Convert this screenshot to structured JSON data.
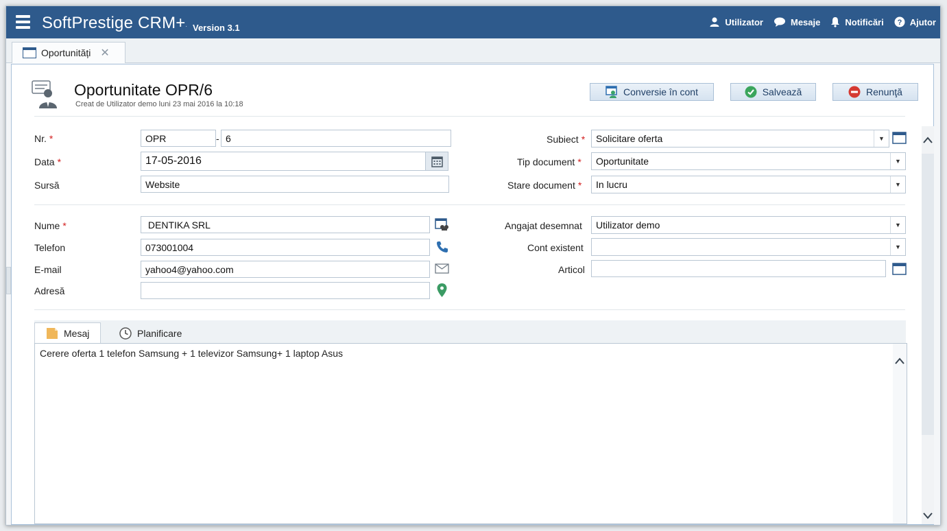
{
  "app": {
    "title": "SoftPrestige CRM+",
    "separator": "·",
    "version": "Version 3.1",
    "brand_color": "#2e5a8c"
  },
  "topnav": {
    "user": "Utilizator",
    "messages": "Mesaje",
    "notifications": "Notificări",
    "help": "Ajutor"
  },
  "tabs": [
    {
      "label": "Oportunități",
      "close": "✕"
    }
  ],
  "header": {
    "title": "Oportunitate OPR/6",
    "created": "Creat de Utilizator demo luni 23 mai 2016 la 10:18"
  },
  "actions": {
    "convert": "Conversie în cont",
    "save": "Salvează",
    "cancel": "Renunţă"
  },
  "form": {
    "nr_label": "Nr.",
    "nr_prefix": "OPR",
    "nr_dash": "-",
    "nr_value": "6",
    "date_label": "Data",
    "date_value": "17-05-2016",
    "source_label": "Sursă",
    "source_value": "Website",
    "name_label": "Nume",
    "name_value": " DENTIKA SRL",
    "phone_label": "Telefon",
    "phone_value": "073001004",
    "email_label": "E-mail",
    "email_value": "yahoo4@yahoo.com",
    "address_label": "Adresă",
    "address_value": "",
    "subject_label": "Subiect",
    "subject_value": "Solicitare oferta",
    "doc_type_label": "Tip document",
    "doc_type_value": "Oportunitate",
    "doc_state_label": "Stare document",
    "doc_state_value": "In lucru",
    "assigned_label": "Angajat desemnat",
    "assigned_value": "Utilizator demo",
    "account_label": "Cont existent",
    "account_value": "",
    "article_label": "Articol",
    "article_value": "",
    "required_mark": "*"
  },
  "subtabs": {
    "message": "Mesaj",
    "planning": "Planificare"
  },
  "message_text": "Cerere oferta 1 telefon Samsung + 1 televizor Samsung+ 1 laptop Asus"
}
